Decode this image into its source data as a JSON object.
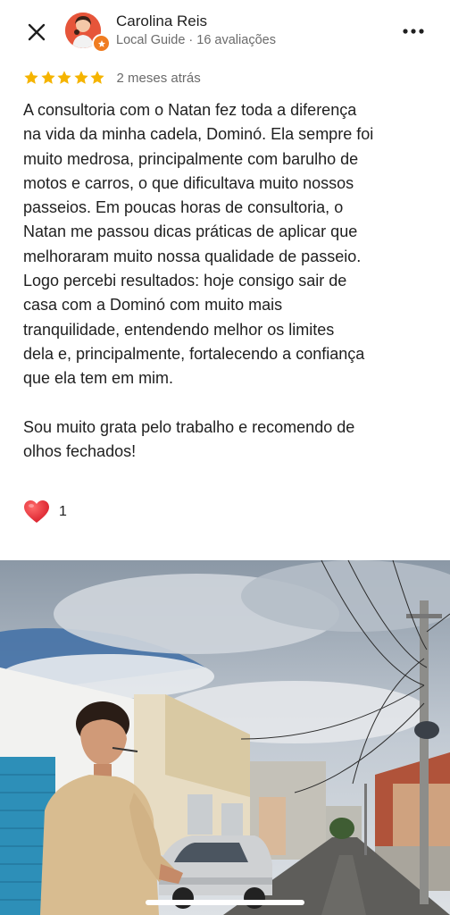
{
  "header": {
    "reviewer_name": "Carolina Reis",
    "reviewer_meta": "Local Guide · 16 avaliações",
    "close_icon": "close-icon",
    "menu_icon": "more-vert-icon",
    "badge_color": "#f07c21"
  },
  "review": {
    "rating": 5,
    "rating_max": 5,
    "star_color": "#f5b400",
    "date": "2 meses atrás",
    "paragraph_1": "A consultoria com o Natan fez toda a diferença\nna vida da minha cadela, Dominó. Ela sempre foi\nmuito medrosa, principalmente com barulho de\nmotos e carros, o que dificultava muito nossos\npasseios. Em poucas horas de consultoria, o\nNatan me passou dicas práticas de aplicar que\nmelhoraram muito nossa qualidade de passeio.\nLogo percebi resultados: hoje consigo sair de\ncasa com a Dominó com muito mais\ntranquilidade, entendendo melhor os limites\ndela e, principalmente, fortalecendo a confiança\nque ela tem em mim.",
    "paragraph_2": "Sou muito grata pelo trabalho e recomendo de\nolhos fechados!"
  },
  "reactions": {
    "icon": "heart-icon",
    "count": "1"
  },
  "photo": {
    "icon": "review-photo"
  }
}
